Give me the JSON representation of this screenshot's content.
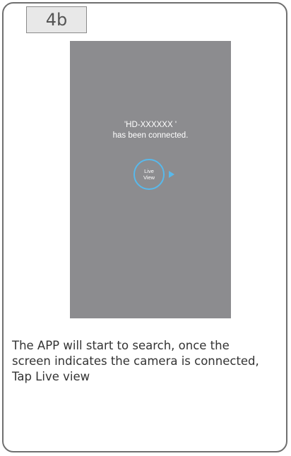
{
  "step": {
    "label": "4b"
  },
  "phone_screen": {
    "device_name": "'HD-XXXXXX '",
    "status_text": "has been connected.",
    "live_view_button": {
      "line1": "Live",
      "line2": "View"
    }
  },
  "caption": {
    "lines": [
      "The APP will start to search, once the",
      "screen indicates the camera is connected,",
      "Tap Live view"
    ]
  },
  "colors": {
    "screen_background": "#8c8c8f",
    "accent_blue": "#58b9ec",
    "card_border": "#6f6f6f",
    "step_tab_background": "#e8e8e8"
  }
}
